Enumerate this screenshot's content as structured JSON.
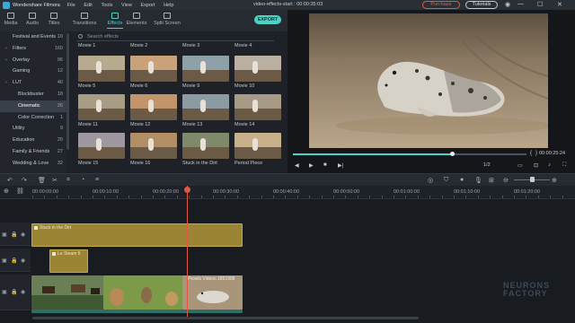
{
  "titlebar": {
    "app_name": "Wondershare Filmora",
    "menu": [
      "File",
      "Edit",
      "Tools",
      "View",
      "Export",
      "Help"
    ],
    "document": "video-effects-start : 00:00:35:03",
    "purchase": "Purchase",
    "tutorials": "Tutorials",
    "minimize": "—",
    "maximize": "☐",
    "close": "✕"
  },
  "tabs": [
    {
      "label": "Media",
      "icon": "media-icon"
    },
    {
      "label": "Audio",
      "icon": "audio-icon"
    },
    {
      "label": "Titles",
      "icon": "titles-icon"
    },
    {
      "label": "Transitions",
      "icon": "transitions-icon"
    },
    {
      "label": "Effects",
      "icon": "effects-icon",
      "active": true
    },
    {
      "label": "Elements",
      "icon": "elements-icon"
    },
    {
      "label": "Split Screen",
      "icon": "split-screen-icon"
    }
  ],
  "export_label": "EXPORT",
  "categories": [
    {
      "label": "Festival and Events",
      "count": "10"
    },
    {
      "label": "Filters",
      "count": "160",
      "arrow": true
    },
    {
      "label": "Overlay",
      "count": "96",
      "arrow": true
    },
    {
      "label": "Gaming",
      "count": "12"
    },
    {
      "label": "LUT",
      "count": "40",
      "arrow": true
    },
    {
      "label": "Blockbuster",
      "count": "18",
      "sub": true
    },
    {
      "label": "Cinematic",
      "count": "26",
      "sub": true,
      "selected": true
    },
    {
      "label": "Color Correction",
      "count": "1",
      "sub": true
    },
    {
      "label": "Utility",
      "count": "9"
    },
    {
      "label": "Education",
      "count": "20"
    },
    {
      "label": "Family & Friends",
      "count": "27"
    },
    {
      "label": "Wedding & Love",
      "count": "32"
    }
  ],
  "search_placeholder": "Search effects",
  "top_row_labels": [
    "Movie 1",
    "Movie 2",
    "Movie 3",
    "Movie 4"
  ],
  "effects": [
    {
      "label": "Movie 5",
      "tone": "#b8aa8e"
    },
    {
      "label": "Movie 6",
      "tone": "#c9a27a"
    },
    {
      "label": "Movie 9",
      "tone": "#8fa1a8"
    },
    {
      "label": "Movie 10",
      "tone": "#b9b0a2"
    },
    {
      "label": "Movie 11",
      "tone": "#a89c84"
    },
    {
      "label": "Movie 12",
      "tone": "#c2946a"
    },
    {
      "label": "Movie 13",
      "tone": "#8c9aa1"
    },
    {
      "label": "Movie 14",
      "tone": "#a79a86"
    },
    {
      "label": "Movie 15",
      "tone": "#9f97a0"
    },
    {
      "label": "Movie 16",
      "tone": "#b38d63"
    },
    {
      "label": "Stuck in the Dirt",
      "tone": "#7f8a6b"
    },
    {
      "label": "Period Piece",
      "tone": "#c7b08a"
    }
  ],
  "player": {
    "timecode": "00:00:25:24",
    "ratio": "1/2",
    "progress": 0.68
  },
  "ruler_times": [
    "00:00:00:00",
    "00:00:10:00",
    "00:00:20:00",
    "00:00:30:00",
    "00:00:40:00",
    "00:00:50:00",
    "00:01:00:00",
    "00:01:10:00",
    "00:01:20:00"
  ],
  "clips": {
    "effect_top": "Stuck in the Dirt",
    "effect_small": "Le Steam II",
    "video_right": "Pexels Videos 1851908"
  },
  "watermark": [
    "NEURONS",
    "FACTORY"
  ]
}
